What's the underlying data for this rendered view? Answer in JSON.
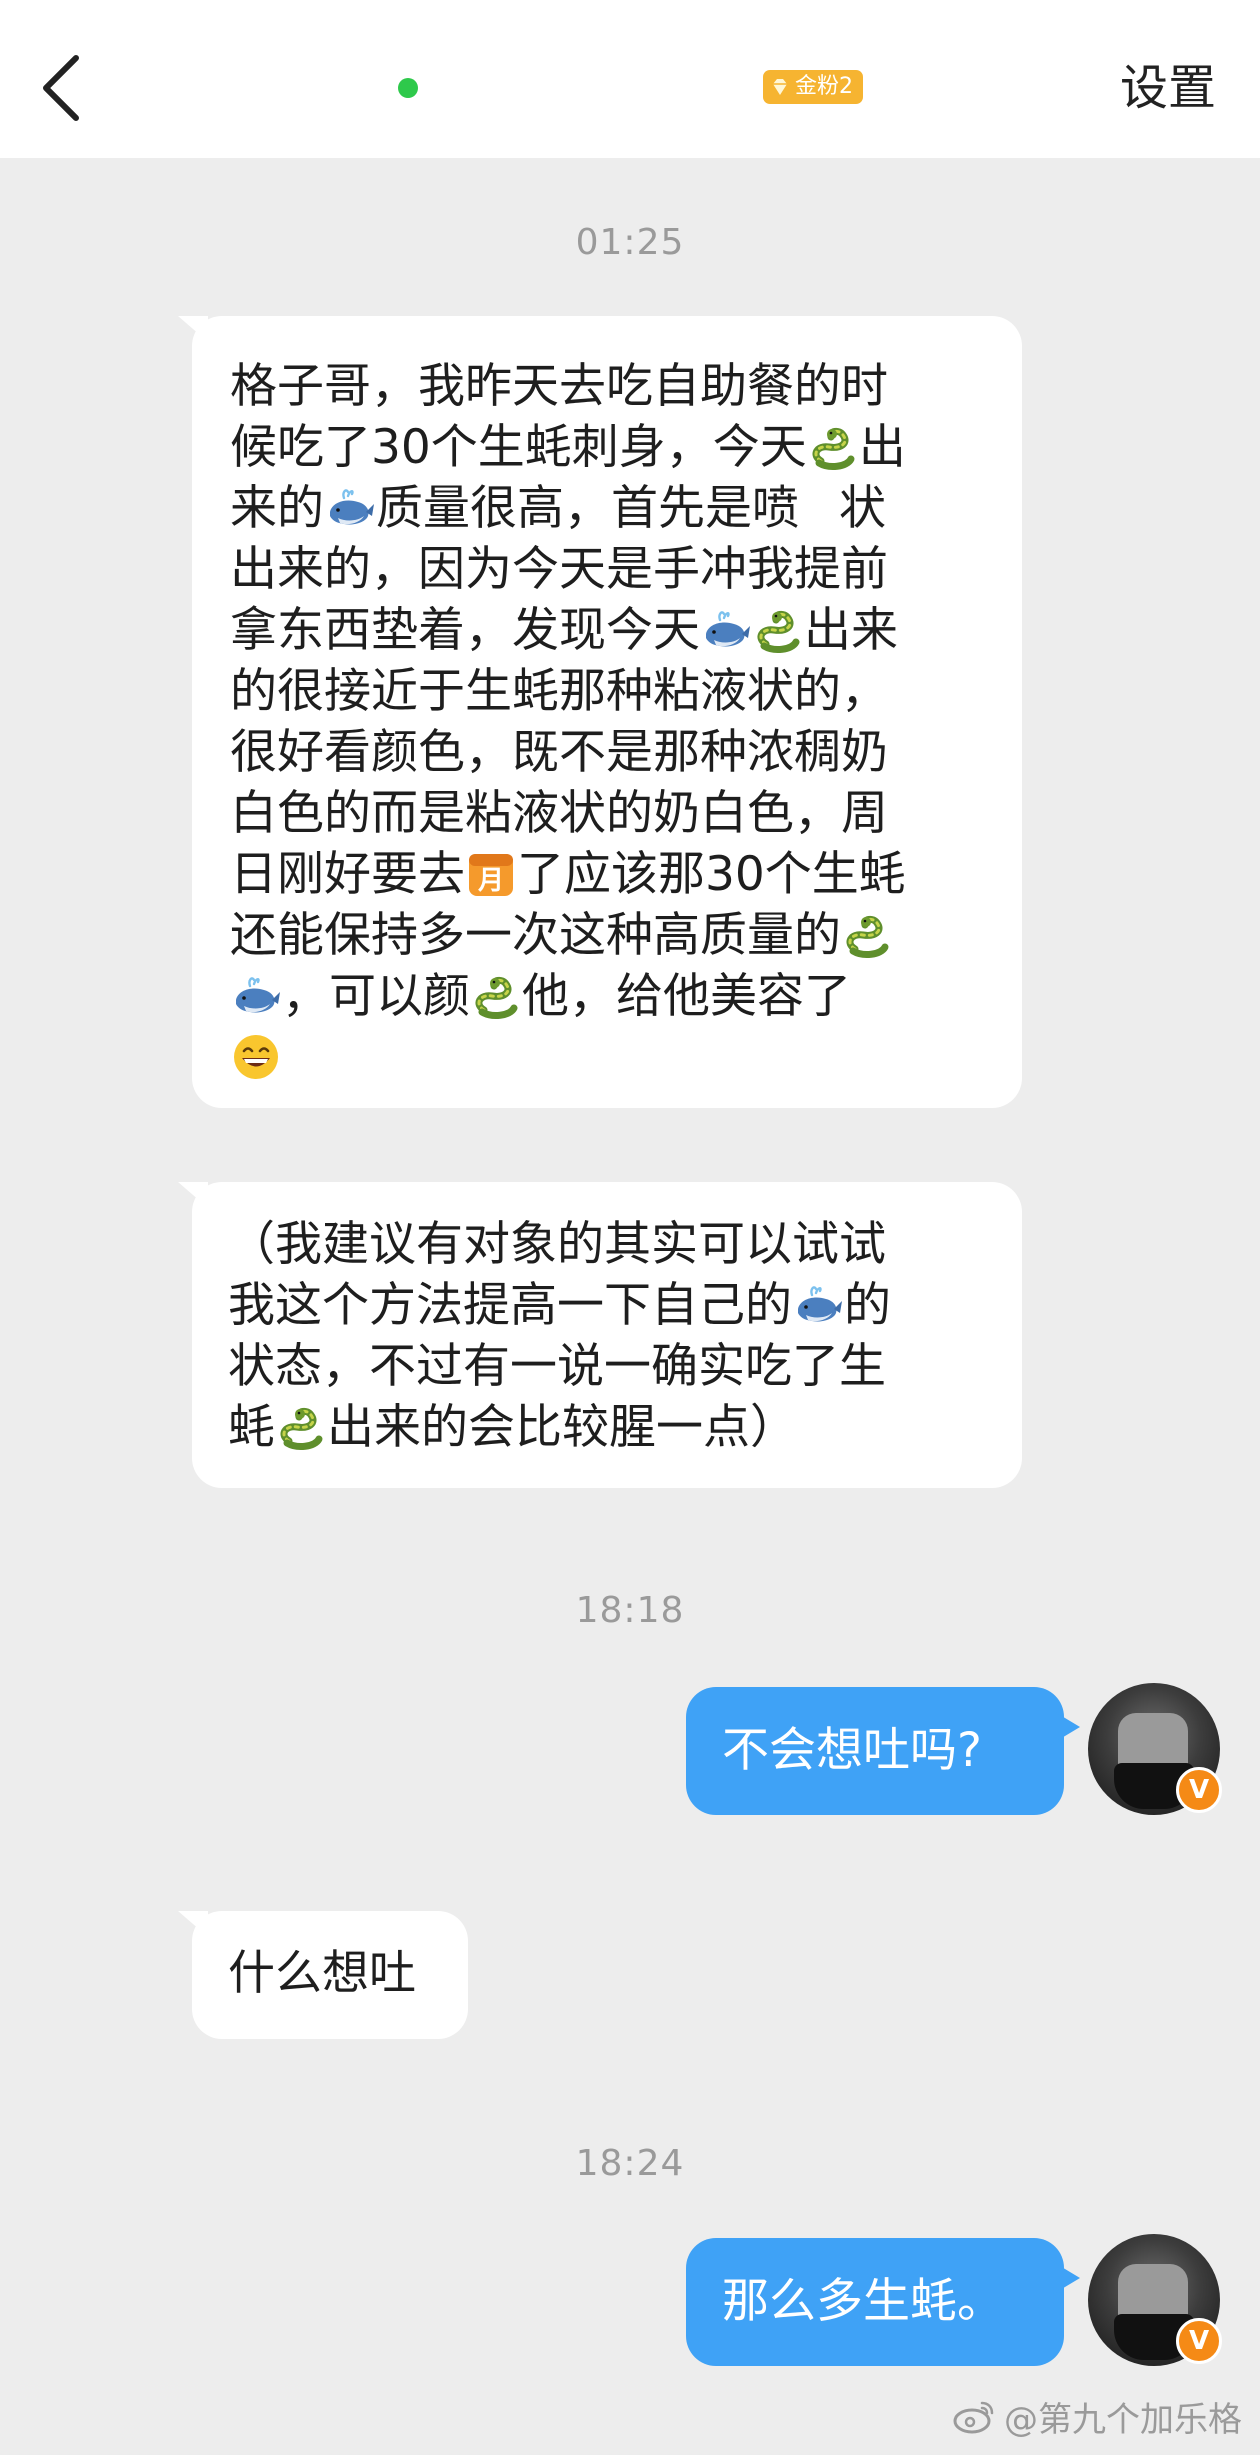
{
  "header": {
    "back_icon": "chevron-left-icon",
    "online_status_color": "#2ec94b",
    "fan_badge_label": "金粉2",
    "settings_label": "设置"
  },
  "messages": {
    "ts1": "01:25",
    "m1_lines": [
      "格子哥，我昨天去吃自助餐的时",
      "候吃了30个生蚝刺身，今天",
      "出",
      "来的",
      "质量很高，首先是喷",
      "状",
      "出来的，因为今天是手冲我提前",
      "拿东西垫着，发现今天",
      "出来",
      "的很接近于生蚝那种粘液状的，",
      "很好看颜色，既不是那种浓稠奶",
      "白色的而是粘液状的奶白色，周",
      "日刚好要去",
      "了应该那30个生蚝",
      "还能保持多一次这种高质量的",
      "，可以颜",
      "他，给他美容了"
    ],
    "m2_lines": [
      "（我建议有对象的其实可以试试",
      "我这个方法提高一下自己的",
      "的",
      "状态，不过有一说一确实吃了生",
      "蚝",
      "出来的会比较腥一点）"
    ],
    "ts2": "18:18",
    "m3": "不会想吐吗?",
    "m4": "什么想吐",
    "ts3": "18:24",
    "m5": "那么多生蚝。"
  },
  "emoji_icons": [
    "snake-icon",
    "whale-icon",
    "calendar-moon-icon",
    "grinning-face-icon",
    "verified-badge-icon"
  ],
  "colors": {
    "sent_bubble": "#3fa2f6",
    "received_bubble": "#ffffff",
    "chat_background": "#ededed",
    "badge_gold": "#f6b431",
    "verified_orange": "#f58a16"
  },
  "watermark": "@第九个加乐格"
}
